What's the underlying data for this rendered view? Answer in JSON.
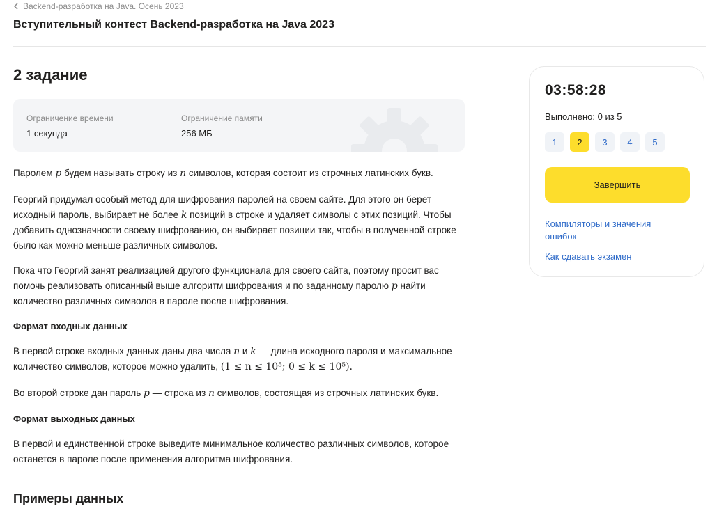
{
  "breadcrumb": {
    "label": "Backend-разработка на Java. Осень 2023"
  },
  "contest": {
    "title": "Вступительный контест Backend-разработка на Java 2023"
  },
  "task": {
    "title": "2 задание",
    "limits": {
      "time_label": "Ограничение времени",
      "time_value": "1 секунда",
      "memory_label": "Ограничение памяти",
      "memory_value": "256 МБ"
    }
  },
  "statement": {
    "p1": [
      "Паролем ",
      "p",
      " будем называть строку из ",
      "n",
      " символов, которая состоит из строчных латинских букв."
    ],
    "p2": [
      "Георгий придумал особый метод для шифрования паролей на своем сайте. Для этого он берет исходный пароль, выбирает не более ",
      "k",
      " позиций в строке и удаляет символы с этих позиций. Чтобы добавить однозначности своему шифрованию, он выбирает позиции так, чтобы в полученной строке было как можно меньше различных символов."
    ],
    "p3": [
      "Пока что Георгий занят реализацией другого функционала для своего сайта, поэтому просит вас помочь реализовать описанный выше алгоритм шифрования и по заданному паролю ",
      "p",
      " найти количество различных символов в пароле после шифрования."
    ],
    "input_heading": "Формат входных данных",
    "input_p1": [
      "В первой строке входных данных даны два числа ",
      "n",
      " и ",
      "k",
      " — длина исходного пароля и максимальное количество символов, которое можно удалить, ",
      "(1 ≤ n ≤ 10⁵; 0 ≤ k ≤ 10⁵)."
    ],
    "input_p2": [
      "Во второй строке дан пароль ",
      "p",
      " — строка из ",
      "n",
      " символов, состоящая из строчных латинских букв."
    ],
    "output_heading": "Формат выходных данных",
    "output_p1": "В первой и единственной строке выведите минимальное количество различных символов, которое останется в пароле после применения алгоритма шифрования."
  },
  "examples": {
    "title": "Примеры данных"
  },
  "sidebar": {
    "timer": "03:58:28",
    "progress": "Выполнено: 0 из 5",
    "tasks": [
      "1",
      "2",
      "3",
      "4",
      "5"
    ],
    "active_task": "2",
    "finish_label": "Завершить",
    "links": [
      "Компиляторы и значения ошибок",
      "Как сдавать экзамен"
    ]
  },
  "colors": {
    "accent": "#fddd2c",
    "link": "#2f6bc9",
    "muted": "#8a8a8a",
    "panel": "#f4f5f7"
  }
}
